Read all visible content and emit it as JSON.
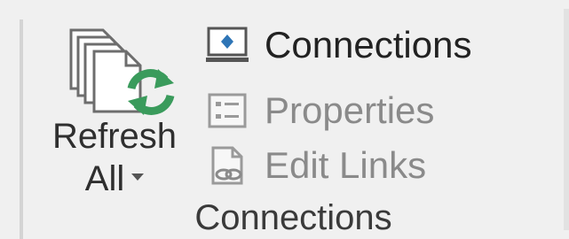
{
  "refresh_all": {
    "label_line1": "Refresh",
    "label_line2": "All",
    "icon": "refresh-all-icon"
  },
  "small_buttons": [
    {
      "label": "Connections",
      "icon": "connections-icon",
      "enabled": true
    },
    {
      "label": "Properties",
      "icon": "properties-icon",
      "enabled": false
    },
    {
      "label": "Edit Links",
      "icon": "edit-links-icon",
      "enabled": false
    }
  ],
  "group": {
    "label": "Connections"
  },
  "colors": {
    "background": "#f0f0f0",
    "refresh_green": "#3a9b5c",
    "connections_blue": "#2e75b6",
    "disabled_text": "#8a8a8a"
  }
}
